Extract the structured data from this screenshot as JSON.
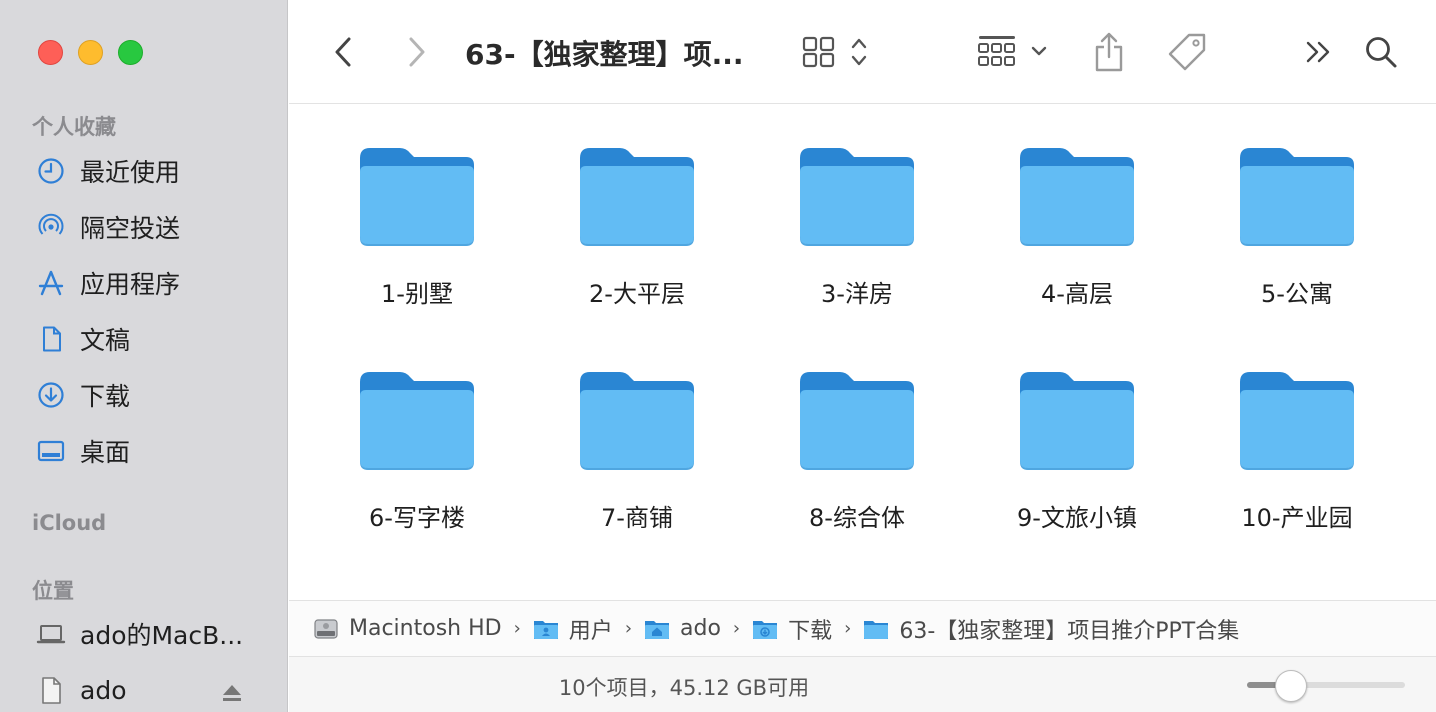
{
  "window": {
    "title": "63-【独家整理】项..."
  },
  "sidebar": {
    "favorites_header": "个人收藏",
    "favorites": [
      {
        "label": "最近使用",
        "icon": "clock-icon"
      },
      {
        "label": "隔空投送",
        "icon": "airdrop-icon"
      },
      {
        "label": "应用程序",
        "icon": "applications-icon"
      },
      {
        "label": "文稿",
        "icon": "document-icon"
      },
      {
        "label": "下载",
        "icon": "download-icon"
      },
      {
        "label": "桌面",
        "icon": "desktop-icon"
      }
    ],
    "icloud_header": "iCloud",
    "locations_header": "位置",
    "locations": [
      {
        "label": "ado的MacB...",
        "icon": "laptop-icon"
      },
      {
        "label": "ado",
        "icon": "file-icon"
      }
    ]
  },
  "folders": [
    {
      "label": "1-别墅"
    },
    {
      "label": "2-大平层"
    },
    {
      "label": "3-洋房"
    },
    {
      "label": "4-高层"
    },
    {
      "label": "5-公寓"
    },
    {
      "label": "6-写字楼"
    },
    {
      "label": "7-商铺"
    },
    {
      "label": "8-综合体"
    },
    {
      "label": "9-文旅小镇"
    },
    {
      "label": "10-产业园"
    }
  ],
  "pathbar": {
    "crumbs": [
      {
        "label": "Macintosh HD",
        "icon": "hard-drive-icon"
      },
      {
        "label": "用户",
        "icon": "users-folder-icon"
      },
      {
        "label": "ado",
        "icon": "home-folder-icon"
      },
      {
        "label": "下载",
        "icon": "downloads-folder-icon"
      },
      {
        "label": "63-【独家整理】项目推介PPT合集",
        "icon": "folder-icon"
      }
    ]
  },
  "status": {
    "text": "10个项目，45.12 GB可用",
    "zoom_level": 0.27
  },
  "colors": {
    "accent": "#2f7fd6",
    "folder_back": "#2a86d3",
    "folder_front": "#62bcf4"
  }
}
